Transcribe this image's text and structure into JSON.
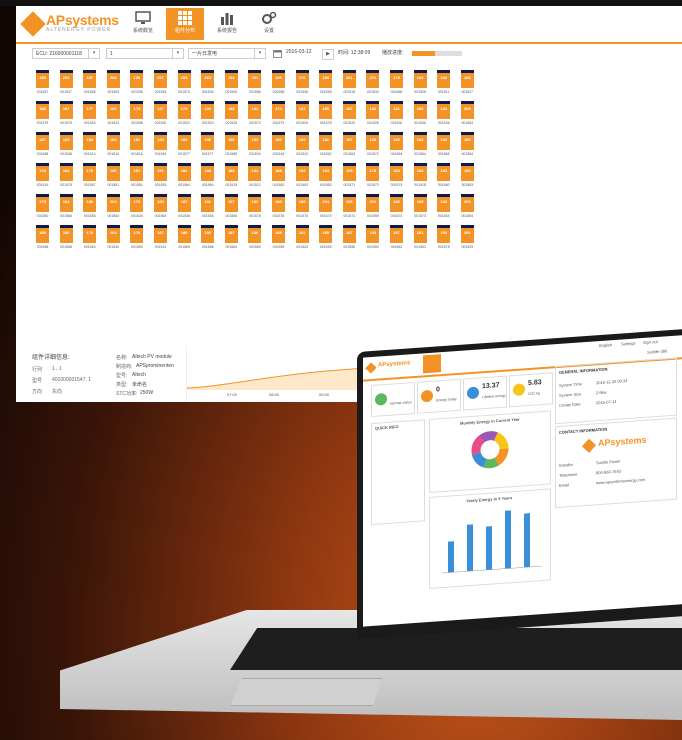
{
  "app": {
    "logo_text": "APsystems",
    "logo_sub": "ALTENERGY POWER",
    "brand_color": "#f39325",
    "nav": [
      {
        "label": "系统概览",
        "icon": "monitor-icon",
        "active": false
      },
      {
        "label": "组件分布",
        "icon": "grid-icon",
        "active": true
      },
      {
        "label": "系统报告",
        "icon": "bar-chart-icon",
        "active": false
      },
      {
        "label": "设置",
        "icon": "gear-icon",
        "active": false
      }
    ]
  },
  "filters": {
    "ecu_id": "ECU: 216000001118",
    "select2": "1",
    "select3": "一片日发电",
    "date": "2016-03-12",
    "play_icon": "play-icon",
    "time_label": "时间: 12:38:09",
    "progress_label": "播放进度:",
    "progress_value": 0.45
  },
  "panels": [
    [
      "189",
      "263",
      "187",
      "208",
      "190",
      "207",
      "188",
      "263",
      "184",
      "201",
      "196",
      "272",
      "189",
      "201",
      "201",
      "178",
      "184",
      "182",
      "188"
    ],
    [
      "186",
      "187",
      "177",
      "189",
      "170",
      "187",
      "175",
      "180",
      "183",
      "182",
      "174",
      "181",
      "185",
      "187",
      "182",
      "181",
      "180",
      "182",
      "205"
    ],
    [
      "187",
      "168",
      "184",
      "184",
      "182",
      "183",
      "184",
      "186",
      "186",
      "183",
      "186",
      "183",
      "182",
      "187",
      "185",
      "186",
      "184",
      "183",
      "180"
    ],
    [
      "178",
      "184",
      "170",
      "186",
      "191",
      "191",
      "184",
      "188",
      "183",
      "184",
      "188",
      "194",
      "184",
      "193",
      "178",
      "183",
      "186",
      "183",
      "190"
    ],
    [
      "175",
      "184",
      "180",
      "204",
      "176",
      "180",
      "187",
      "181",
      "187",
      "182",
      "183",
      "185",
      "204",
      "208",
      "201",
      "186",
      "185",
      "184",
      "203"
    ],
    [
      "189",
      "180",
      "170",
      "203",
      "170",
      "187",
      "186",
      "189",
      "187",
      "186",
      "185",
      "181",
      "185",
      "187",
      "194",
      "187",
      "181",
      "192",
      "200"
    ]
  ],
  "panel_ids": [
    [
      "001567",
      "001547",
      "001565",
      "001563",
      "001536",
      "001554",
      "001573",
      "001506",
      "001506",
      "001586",
      "001558",
      "001546",
      "001548",
      "001518",
      "001533",
      "001566",
      "001528",
      "001511",
      "001527"
    ],
    [
      "001575",
      "001576",
      "001553",
      "001523",
      "001558",
      "001530",
      "001522",
      "001520",
      "001525",
      "001572",
      "001573",
      "001526",
      "001578",
      "001529",
      "001528",
      "001530",
      "001536",
      "001536",
      "001584"
    ],
    [
      "001568",
      "001548",
      "001514",
      "001516",
      "001516",
      "001549",
      "001577",
      "001577",
      "001585",
      "001534",
      "001518",
      "001510",
      "001562",
      "001563",
      "001572",
      "001564",
      "001564",
      "001566",
      "001584"
    ],
    [
      "001519",
      "001578",
      "001587",
      "001581",
      "001551",
      "001553",
      "001564",
      "001564",
      "001515",
      "001512",
      "001562",
      "001563",
      "001563",
      "001571",
      "001573",
      "001574",
      "001518",
      "001560",
      "001583"
    ],
    [
      "001560",
      "001566",
      "001583",
      "001563",
      "001526",
      "001563",
      "001536",
      "001536",
      "001556",
      "001578",
      "001578",
      "001576",
      "001574",
      "001574",
      "001559",
      "001574",
      "001573",
      "001564",
      "001584"
    ],
    [
      "001558",
      "001558",
      "001563",
      "001540",
      "001553",
      "001513",
      "001565",
      "001568",
      "001563",
      "001560",
      "001559",
      "001543",
      "001545",
      "001556",
      "001550",
      "001581",
      "001561",
      "001578",
      "001529"
    ]
  ],
  "detail": {
    "title": "组件详细信息:",
    "row_label": "行列",
    "row_value": "1 , 1",
    "id_label": "型号",
    "id_value": "401000001547. 1",
    "dir_label": "方向",
    "dir_value": "东向",
    "name_label": "名称:",
    "name_value": "Altech PV module",
    "maker_label": "制造商:",
    "maker_value": "APSprominenten",
    "model_label": "型号:",
    "model_value": "Altech",
    "type_label": "类型:",
    "type_value": "未命名",
    "stc_label": "STC功率:",
    "stc_value": "250W"
  },
  "chart": {
    "x_ticks": [
      "07:00",
      "08:00",
      "09:30",
      "10:30"
    ]
  },
  "laptop": {
    "header_links": [
      "English",
      "Settings",
      "Sign out"
    ],
    "user": "Sunlife-386",
    "tiles": [
      {
        "value": "",
        "label": "Normal status",
        "color": "#5cb85c"
      },
      {
        "value": "0",
        "label": "Energy today",
        "color": "#f39325"
      },
      {
        "value": "13.37",
        "label": "Lifetime energy",
        "color": "#3b8fd9"
      },
      {
        "value": "5.83",
        "label": "CO2 kg",
        "color": "#f5c518"
      }
    ],
    "general_title": "GENERAL INFORMATION",
    "general_rows": [
      [
        "System Time",
        "2016-11-30 09:34"
      ],
      [
        "System Size",
        "2.6kw"
      ],
      [
        "Create Date",
        "2015-07-14"
      ]
    ],
    "contact_title": "CONTACT INFORMATION",
    "contact_logo": "APsystems",
    "contact_rows": [
      [
        "Installer",
        "Sunlife Power"
      ],
      [
        "Telephone",
        "800-860-7643"
      ],
      [
        "Email",
        "www.apsystemsenergy.com"
      ]
    ],
    "news_title": "QUICK INFO",
    "donut_title": "Monthly Energy in Current Year",
    "bars_title": "Yearly Energy in 5 Years",
    "bar_values": [
      3,
      4.5,
      4.2,
      5.6,
      5.2
    ]
  }
}
